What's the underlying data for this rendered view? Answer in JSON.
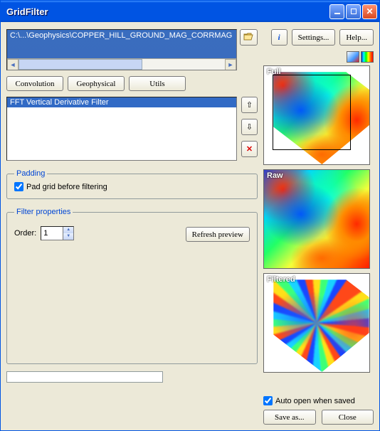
{
  "window": {
    "title": "GridFilter"
  },
  "toolbar": {
    "path": "C:\\...\\Geophysics\\COPPER_HILL_GROUND_MAG_CORRMAG",
    "settings_label": "Settings...",
    "help_label": "Help..."
  },
  "tabs": {
    "convolution": "Convolution",
    "geophysical": "Geophysical",
    "utils": "Utils"
  },
  "filters": {
    "items": [
      "FFT Vertical Derivative Filter"
    ]
  },
  "padding": {
    "legend": "Padding",
    "checkbox_label": "Pad grid before filtering",
    "checked": true
  },
  "filter_properties": {
    "legend": "Filter properties",
    "order_label": "Order:",
    "order_value": "1",
    "refresh_label": "Refresh preview"
  },
  "previews": {
    "full": "Full",
    "raw": "Raw",
    "filtered": "Filtered"
  },
  "footer": {
    "auto_open_label": "Auto open when saved",
    "auto_open_checked": true,
    "save_label": "Save as...",
    "close_label": "Close"
  }
}
